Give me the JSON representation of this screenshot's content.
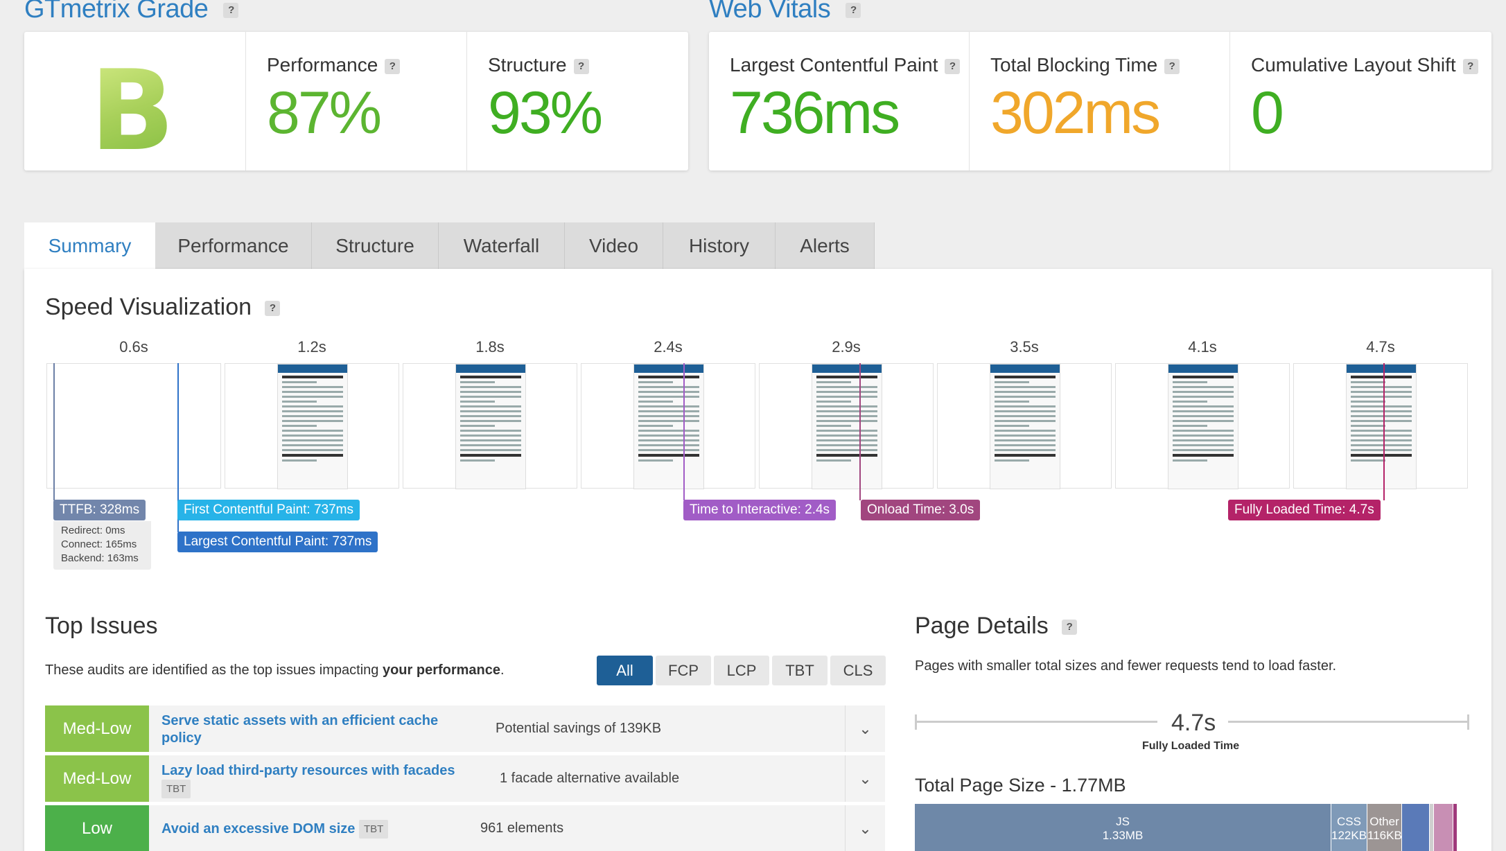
{
  "grade_section": {
    "title": "GTmetrix Grade",
    "help": "?",
    "grade": "B",
    "performance": {
      "label": "Performance",
      "value": "87%"
    },
    "structure": {
      "label": "Structure",
      "value": "93%"
    }
  },
  "vitals_section": {
    "title": "Web Vitals",
    "help": "?",
    "lcp": {
      "label": "Largest Contentful Paint",
      "value": "736ms"
    },
    "tbt": {
      "label": "Total Blocking Time",
      "value": "302ms"
    },
    "cls": {
      "label": "Cumulative Layout Shift",
      "value": "0"
    }
  },
  "tabs": [
    "Summary",
    "Performance",
    "Structure",
    "Waterfall",
    "Video",
    "History",
    "Alerts"
  ],
  "speed": {
    "title": "Speed Visualization",
    "help": "?",
    "times": [
      "0.6s",
      "1.2s",
      "1.8s",
      "2.4s",
      "2.9s",
      "3.5s",
      "4.1s",
      "4.7s"
    ],
    "markers": {
      "ttfb": "TTFB: 328ms",
      "redirect": "Redirect: 0ms",
      "connect": "Connect: 165ms",
      "backend": "Backend: 163ms",
      "fcp": "First Contentful Paint: 737ms",
      "lcp": "Largest Contentful Paint: 737ms",
      "tti": "Time to Interactive: 2.4s",
      "onload": "Onload Time: 3.0s",
      "fully": "Fully Loaded Time: 4.7s"
    }
  },
  "top_issues": {
    "title": "Top Issues",
    "intro": "These audits are identified as the top issues impacting ",
    "intro_bold": "your performance",
    "intro_end": ".",
    "filters": [
      "All",
      "FCP",
      "LCP",
      "TBT",
      "CLS"
    ],
    "items": [
      {
        "severity": "Med-Low",
        "title": "Serve static assets with an efficient cache policy",
        "tag": "",
        "value": "Potential savings of 139KB"
      },
      {
        "severity": "Med-Low",
        "title": "Lazy load third-party resources with facades",
        "tag": "TBT",
        "value": "1 facade alternative available"
      },
      {
        "severity": "Low",
        "title": "Avoid an excessive DOM size",
        "tag": "TBT",
        "value": "961 elements"
      }
    ]
  },
  "page_details": {
    "title": "Page Details",
    "help": "?",
    "intro": "Pages with smaller total sizes and fewer requests tend to load faster.",
    "fully_loaded_value": "4.7s",
    "fully_loaded_label": "Fully Loaded Time",
    "total_size_label": "Total Page Size - 1.77MB",
    "segments": [
      {
        "name": "JS",
        "size": "1.33MB",
        "color": "#6e88a8"
      },
      {
        "name": "CSS",
        "size": "122KB",
        "color": "#7f9ab8"
      },
      {
        "name": "Other",
        "size": "116KB",
        "color": "#9c9594"
      }
    ]
  },
  "colors": {
    "accent": "#2f7fc1",
    "green": "#4caf2f",
    "orange": "#f0a72b",
    "medlow": "#8bc34a",
    "low": "#4caf50",
    "navy": "#1e5f96"
  }
}
